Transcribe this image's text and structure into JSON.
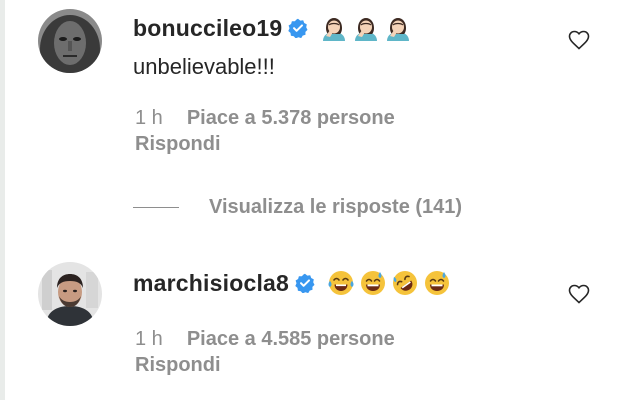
{
  "comments": [
    {
      "username": "bonuccileo19",
      "verified": true,
      "text": "unbelievable!!!",
      "emojis_after_name": [
        "man-facepalming-icon",
        "man-facepalming-icon",
        "man-facepalming-icon"
      ],
      "time": "1 h",
      "likes": "Piace a 5.378 persone",
      "reply": "Rispondi"
    },
    {
      "username": "marchisiocla8",
      "verified": true,
      "text": "",
      "emojis_after_name": [
        "face-with-tears-of-joy-icon",
        "grinning-sweat-icon",
        "rolling-on-floor-laughing-icon",
        "grinning-sweat-icon"
      ],
      "time": "1 h",
      "likes": "Piace a 4.585 persone",
      "reply": "Rispondi"
    }
  ],
  "view_replies": "Visualizza le risposte (141)",
  "colors": {
    "text_primary": "#262626",
    "text_secondary": "#8e8e8e",
    "verified_blue": "#3897f0",
    "background": "#ffffff",
    "page_edge": "#e9ecea"
  }
}
